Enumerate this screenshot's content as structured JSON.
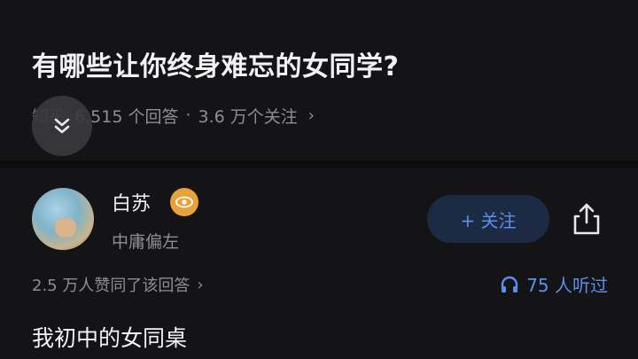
{
  "question": {
    "title": "有哪些让你终身难忘的女同学?",
    "meta_prefix": "知乎",
    "answers_count": "6,515 个回答",
    "separator": "·",
    "followers_count": "3.6 万个关注",
    "more_chevron": "›"
  },
  "collapse_button": {
    "icon": "double-chevron-down-icon"
  },
  "author": {
    "name": "白苏",
    "badge_icon": "eye-badge-icon",
    "bio": "中庸偏左",
    "follow_label": "+ 关注",
    "share_icon": "share-icon"
  },
  "answer": {
    "votes_text": "2.5 万人赞同了该回答",
    "votes_chevron": "›",
    "listened_text": "75 人听过",
    "first_line": "我初中的女同桌"
  },
  "colors": {
    "background": "#141416",
    "accent": "#5b8fe8",
    "muted_text": "#8e8e93",
    "follow_bg": "#1c2a44",
    "badge": "#e8a23a"
  }
}
